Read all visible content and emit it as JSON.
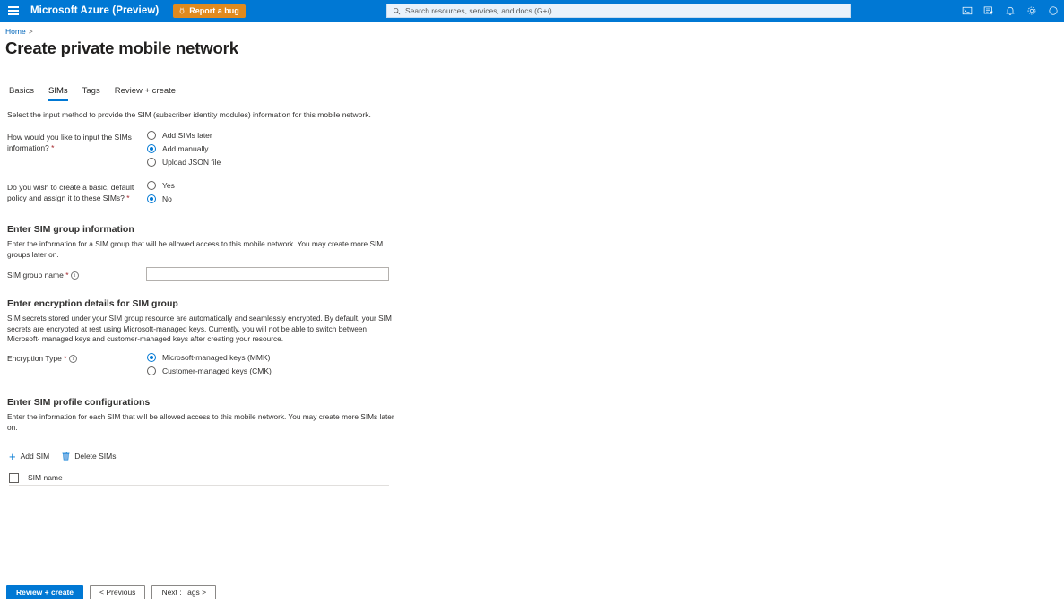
{
  "header": {
    "menu_icon": "hamburger-menu-icon",
    "brand": "Microsoft Azure (Preview)",
    "report_bug_label": "Report a bug",
    "report_bug_color": "#e08a1e",
    "accent_color": "#0078d4",
    "search_placeholder": "Search resources, services, and docs (G+/)",
    "icons": [
      {
        "name": "cloud-shell-icon"
      },
      {
        "name": "directories-filter-icon"
      },
      {
        "name": "notifications-bell-icon"
      },
      {
        "name": "settings-gear-icon"
      },
      {
        "name": "help-icon"
      }
    ]
  },
  "breadcrumb": {
    "home": "Home",
    "separator": ">"
  },
  "page": {
    "title": "Create private mobile network",
    "more_menu": "···"
  },
  "tabs": [
    {
      "label": "Basics",
      "active": false
    },
    {
      "label": "SIMs",
      "active": true
    },
    {
      "label": "Tags",
      "active": false
    },
    {
      "label": "Review + create",
      "active": false
    }
  ],
  "intro": "Select the input method to provide the SIM (subscriber identity modules) information for this mobile network.",
  "input_method": {
    "label_line1": "How would you like to input the SIMs",
    "label_line2": "information? *",
    "options": [
      {
        "label": "Add SIMs later",
        "selected": false
      },
      {
        "label": "Add manually",
        "selected": true
      },
      {
        "label": "Upload JSON file",
        "selected": false
      }
    ]
  },
  "default_policy": {
    "label_line1": "Do you wish to create a basic, default",
    "label_line2": "policy and assign it to these SIMs? *",
    "options": [
      {
        "label": "Yes",
        "selected": false
      },
      {
        "label": "No",
        "selected": true
      }
    ]
  },
  "sim_group": {
    "heading": "Enter SIM group information",
    "description_line1": "Enter the information for a SIM group that will be allowed access to this mobile network. You may create more SIM",
    "description_line2": "groups later on.",
    "name_label": "SIM group name *",
    "name_value": "",
    "name_placeholder": "",
    "info_glyph": "i"
  },
  "encryption": {
    "heading": "Enter encryption details for SIM group",
    "description_line1": "SIM secrets stored under your SIM group resource are automatically and seamlessly encrypted. By default, your SIM",
    "description_line2": "secrets are encrypted at rest using Microsoft-managed keys. Currently, you will not be able to switch between Microsoft-",
    "description_line3": "managed keys and customer-managed keys after creating your resource.",
    "type_label": "Encryption Type *",
    "info_glyph": "i",
    "options": [
      {
        "label": "Microsoft-managed keys (MMK)",
        "selected": true
      },
      {
        "label": "Customer-managed keys (CMK)",
        "selected": false
      }
    ]
  },
  "sim_profiles": {
    "heading": "Enter SIM profile configurations",
    "description_line1": "Enter the information for each SIM that will be allowed access to this mobile network. You may create more SIMs later",
    "description_line2": "on.",
    "add_sim_label": "Add SIM",
    "add_sim_icon": "plus-icon",
    "delete_sims_label": "Delete SIMs",
    "delete_sims_icon": "trash-icon",
    "column_header": "SIM name",
    "rows": []
  },
  "footer": {
    "review_create": "Review + create",
    "previous": "< Previous",
    "next": "Next : Tags >"
  }
}
